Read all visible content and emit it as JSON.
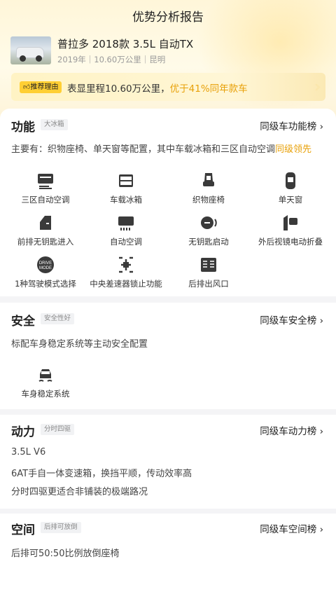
{
  "page_title": "优势分析报告",
  "car": {
    "name": "普拉多 2018款 3.5L 自动TX",
    "meta": "2019年｜10.60万公里｜昆明"
  },
  "reason": {
    "tag": "推荐理由",
    "text_prefix": "表显里程10.60万公里，",
    "text_highlight": "优于41%同年款车"
  },
  "sections": {
    "function": {
      "title": "功能",
      "tag": "大冰箱",
      "rank_link": "同级车功能榜 ›",
      "desc_prefix": "主要有：织物座椅、单天窗等配置，其中车载冰箱和三区自动空调",
      "desc_highlight": "同级领先",
      "features": [
        {
          "label": "三区自动空调",
          "icon": "ac-icon"
        },
        {
          "label": "车载冰箱",
          "icon": "fridge-icon"
        },
        {
          "label": "织物座椅",
          "icon": "seat-icon"
        },
        {
          "label": "单天窗",
          "icon": "sunroof-icon"
        },
        {
          "label": "前排无钥匙进入",
          "icon": "door-keyless-icon"
        },
        {
          "label": "自动空调",
          "icon": "auto-ac-icon"
        },
        {
          "label": "无钥匙启动",
          "icon": "start-button-icon"
        },
        {
          "label": "外后视镜电动折叠",
          "icon": "mirror-fold-icon"
        },
        {
          "label": "1种驾驶模式选择",
          "icon": "drive-mode-icon"
        },
        {
          "label": "中央差速器锁止功能",
          "icon": "diff-lock-icon"
        },
        {
          "label": "后排出风口",
          "icon": "rear-vent-icon"
        }
      ]
    },
    "safety": {
      "title": "安全",
      "tag": "安全性好",
      "rank_link": "同级车安全榜 ›",
      "desc": "标配车身稳定系统等主动安全配置",
      "features": [
        {
          "label": "车身稳定系统",
          "icon": "esp-icon"
        }
      ]
    },
    "power": {
      "title": "动力",
      "tag": "分时四驱",
      "rank_link": "同级车动力榜 ›",
      "lines": [
        "3.5L V6",
        "6AT手自一体变速箱，换挡平顺，传动效率高",
        "分时四驱更适合非铺装的极端路况"
      ]
    },
    "space": {
      "title": "空间",
      "tag": "后排可放倒",
      "rank_link": "同级车空间榜 ›",
      "desc": "后排可50:50比例放倒座椅"
    }
  },
  "colors": {
    "accent": "#e8a10a",
    "tag_yellow": "#ffcf33",
    "page_bg": "#f4f4f6"
  }
}
